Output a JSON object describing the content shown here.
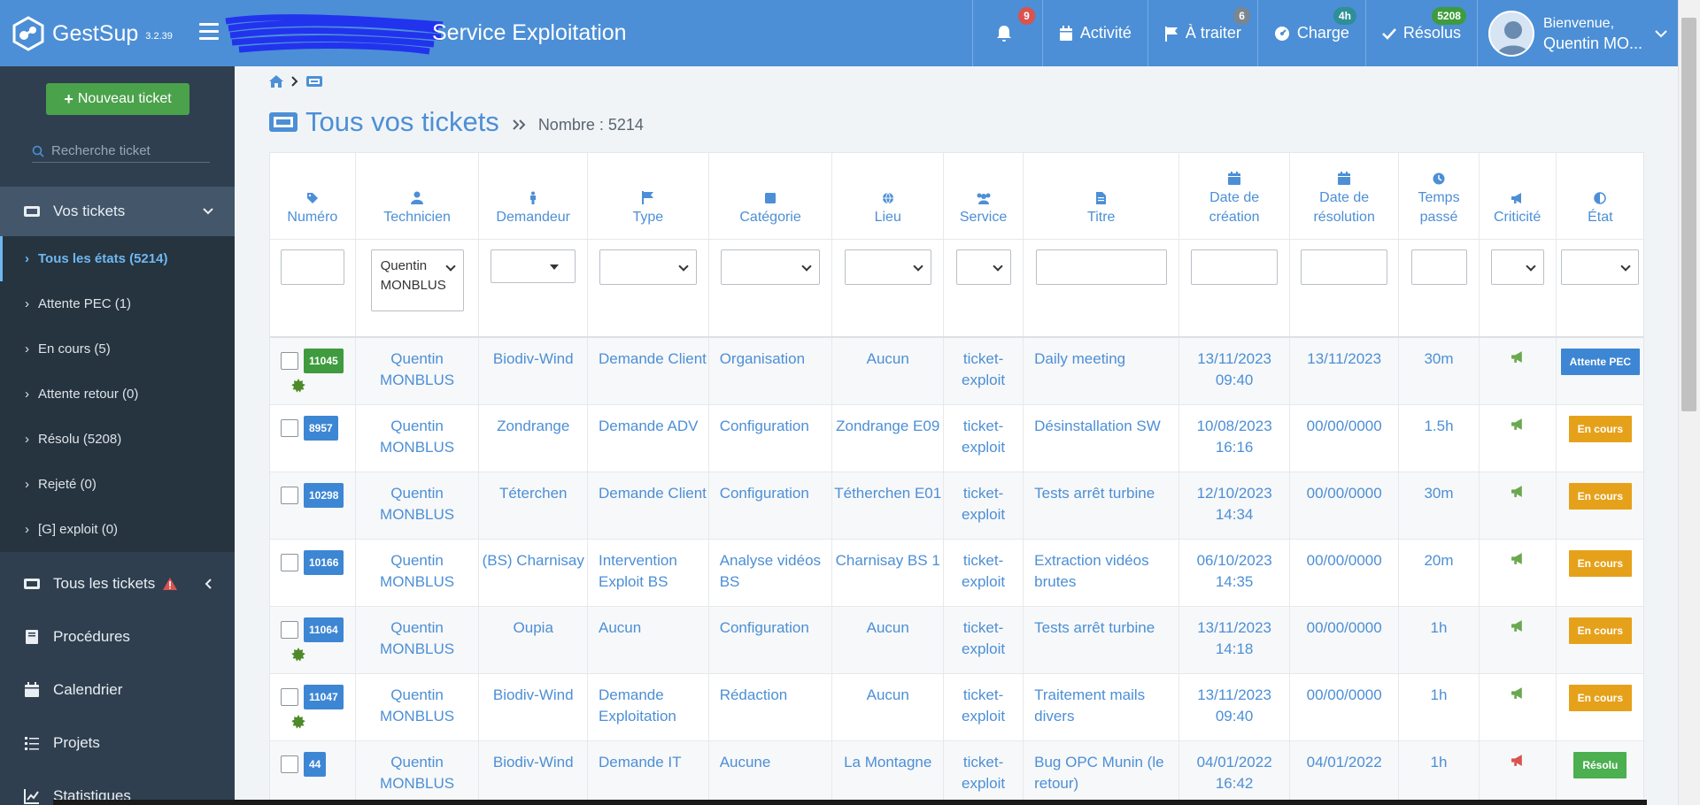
{
  "app": {
    "name": "GestSup",
    "version": "3.2.39",
    "page_title": "Service Exploitation"
  },
  "topnav": {
    "notifications": {
      "badge": "9",
      "badge_color": "#d9534f"
    },
    "activity": {
      "label": "Activité"
    },
    "todo": {
      "label": "À traiter",
      "badge": "6",
      "badge_color": "#7a8690"
    },
    "load": {
      "label": "Charge",
      "badge": "4h",
      "badge_color": "#2e8f96"
    },
    "resolved": {
      "label": "Résolus",
      "badge": "5208",
      "badge_color": "#3e9b3e"
    },
    "user": {
      "greeting": "Bienvenue,",
      "name": "Quentin MO..."
    }
  },
  "sidebar": {
    "new_ticket": "Nouveau ticket",
    "search_placeholder": "Recherche ticket",
    "section": "Vos tickets",
    "sub_items": [
      {
        "label": "Tous les états (5214)"
      },
      {
        "label": "Attente PEC (1)"
      },
      {
        "label": "En cours (5)"
      },
      {
        "label": "Attente retour (0)"
      },
      {
        "label": "Résolu (5208)"
      },
      {
        "label": "Rejeté (0)"
      },
      {
        "label": "[G] exploit (0)"
      }
    ],
    "all_tickets": "Tous les tickets",
    "procedures": "Procédures",
    "calendar": "Calendrier",
    "projects": "Projets",
    "stats": "Statistiques"
  },
  "main": {
    "title": "Tous vos tickets",
    "count": "Nombre : 5214",
    "columns": {
      "numero": "Numéro",
      "technicien": "Technicien",
      "demandeur": "Demandeur",
      "type": "Type",
      "categorie": "Catégorie",
      "lieu": "Lieu",
      "service": "Service",
      "titre": "Titre",
      "date_creation_1": "Date de",
      "date_creation_2": "création",
      "date_resolution_1": "Date de",
      "date_resolution_2": "résolution",
      "temps_1": "Temps",
      "temps_2": "passé",
      "criticite": "Criticité",
      "etat": "État"
    },
    "filter_tech": "Quentin MONBLUS",
    "rows": [
      {
        "num": "11045",
        "num_color": "#3e9b3e",
        "new": true,
        "tech": "Quentin MONBLUS",
        "demandeur": "Biodiv-Wind",
        "type": "Demande Client",
        "cat": "Organisation",
        "lieu": "Aucun",
        "service": "ticket-exploit",
        "titre": "Daily meeting",
        "created": "13/11/2023 09:40",
        "resolved": "13/11/2023",
        "time": "30m",
        "crit_color": "#6aa84f",
        "state": "Attente PEC",
        "state_color": "#3d86d4"
      },
      {
        "num": "8957",
        "num_color": "#3d86d4",
        "new": false,
        "tech": "Quentin MONBLUS",
        "demandeur": "Zondrange",
        "type": "Demande ADV",
        "cat": "Configuration",
        "lieu": "Zondrange E09",
        "service": "ticket-exploit",
        "titre": "Désinstallation SW",
        "created": "10/08/2023 16:16",
        "resolved": "00/00/0000",
        "time": "1.5h",
        "crit_color": "#6aa84f",
        "state": "En cours",
        "state_color": "#e6a11a"
      },
      {
        "num": "10298",
        "num_color": "#3d86d4",
        "new": false,
        "tech": "Quentin MONBLUS",
        "demandeur": "Téterchen",
        "type": "Demande Client",
        "cat": "Configuration",
        "lieu": "Tétherchen E01",
        "service": "ticket-exploit",
        "titre": "Tests arrêt turbine",
        "created": "12/10/2023 14:34",
        "resolved": "00/00/0000",
        "time": "30m",
        "crit_color": "#6aa84f",
        "state": "En cours",
        "state_color": "#e6a11a"
      },
      {
        "num": "10166",
        "num_color": "#3d86d4",
        "new": false,
        "tech": "Quentin MONBLUS",
        "demandeur": "(BS) Charnisay",
        "type": "Intervention Exploit BS",
        "cat": "Analyse vidéos BS",
        "lieu": "Charnisay BS 1",
        "service": "ticket-exploit",
        "titre": "Extraction vidéos brutes",
        "created": "06/10/2023 14:35",
        "resolved": "00/00/0000",
        "time": "20m",
        "crit_color": "#6aa84f",
        "state": "En cours",
        "state_color": "#e6a11a"
      },
      {
        "num": "11064",
        "num_color": "#3d86d4",
        "new": true,
        "tech": "Quentin MONBLUS",
        "demandeur": "Oupia",
        "type": "Aucun",
        "cat": "Configuration",
        "lieu": "Aucun",
        "service": "ticket-exploit",
        "titre": "Tests arrêt turbine",
        "created": "13/11/2023 14:18",
        "resolved": "00/00/0000",
        "time": "1h",
        "crit_color": "#6aa84f",
        "state": "En cours",
        "state_color": "#e6a11a"
      },
      {
        "num": "11047",
        "num_color": "#3d86d4",
        "new": true,
        "tech": "Quentin MONBLUS",
        "demandeur": "Biodiv-Wind",
        "type": "Demande Exploitation",
        "cat": "Rédaction",
        "lieu": "Aucun",
        "service": "ticket-exploit",
        "titre": "Traitement mails divers",
        "created": "13/11/2023 09:40",
        "resolved": "00/00/0000",
        "time": "1h",
        "crit_color": "#6aa84f",
        "state": "En cours",
        "state_color": "#e6a11a"
      },
      {
        "num": "44",
        "num_color": "#3d86d4",
        "new": false,
        "tech": "Quentin MONBLUS",
        "demandeur": "Biodiv-Wind",
        "type": "Demande IT",
        "cat": "Aucune",
        "lieu": "La Montagne",
        "service": "ticket-exploit",
        "titre": "Bug OPC Munin (le retour)",
        "created": "04/01/2022 16:42",
        "resolved": "04/01/2022",
        "time": "1h",
        "crit_color": "#d9534f",
        "state": "Résolu",
        "state_color": "#4caf50"
      }
    ]
  }
}
